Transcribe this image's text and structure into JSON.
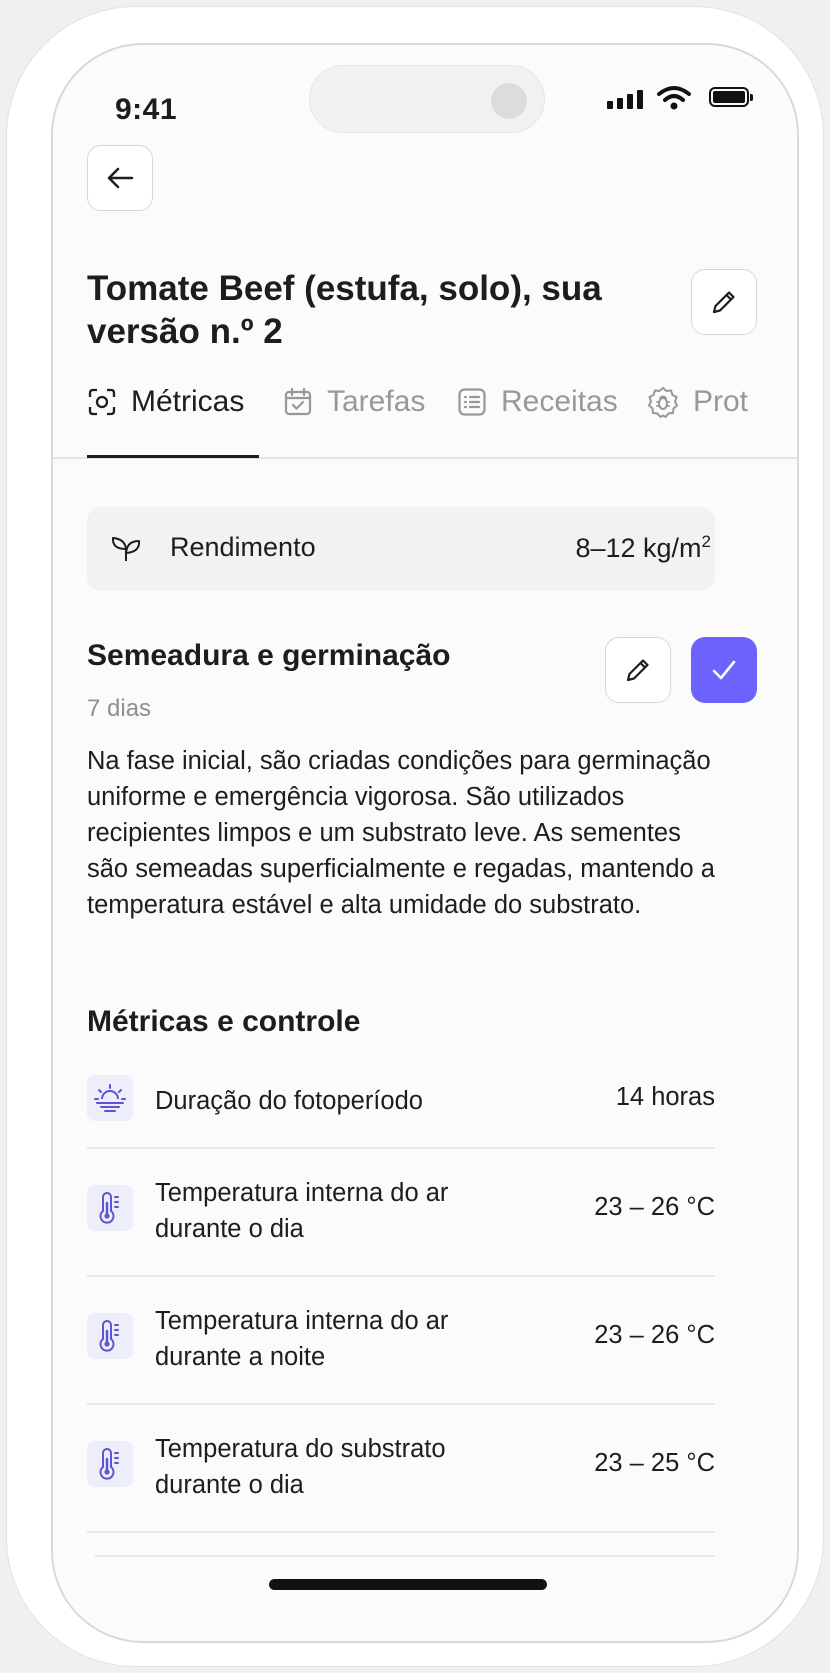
{
  "status_bar": {
    "time": "9:41"
  },
  "header": {
    "title": "Tomate Beef (estufa, solo), sua versão n.º 2"
  },
  "tabs": [
    {
      "label": "Métricas",
      "icon": "scan-icon",
      "active": true
    },
    {
      "label": "Tarefas",
      "icon": "calendar-check-icon",
      "active": false
    },
    {
      "label": "Receitas",
      "icon": "list-icon",
      "active": false
    },
    {
      "label": "Prot",
      "icon": "bug-icon",
      "active": false
    }
  ],
  "yield": {
    "label": "Rendimento",
    "value": "8–12 kg/m",
    "unit_sup": "2",
    "icon": "sprout-icon"
  },
  "stage": {
    "title": "Semeadura e germinação",
    "duration": "7 dias",
    "description": "Na fase inicial, são criadas condições para germinação uniforme e emergência vigorosa. São utilizados recipientes limpos e um substrato leve. As sementes são semeadas superficialmente e regadas, mantendo a temperatura estável e alta umidade do substrato."
  },
  "metrics": {
    "heading": "Métricas e controle",
    "rows": [
      {
        "label": "Duração do fotoperíodo",
        "value": "14 horas",
        "icon": "sunrise-icon"
      },
      {
        "label": "Temperatura interna do ar durante o dia",
        "value": "23 – 26 °C",
        "icon": "thermometer-icon"
      },
      {
        "label": "Temperatura interna do ar durante a noite",
        "value": "23 – 26 °C",
        "icon": "thermometer-icon"
      },
      {
        "label": "Temperatura do substrato durante o dia",
        "value": "23 – 25 °C",
        "icon": "thermometer-icon"
      }
    ]
  },
  "colors": {
    "accent": "#6C63FF",
    "icon_bg": "#EEEEFA",
    "text": "#1D1D1F",
    "muted": "#98989C"
  }
}
